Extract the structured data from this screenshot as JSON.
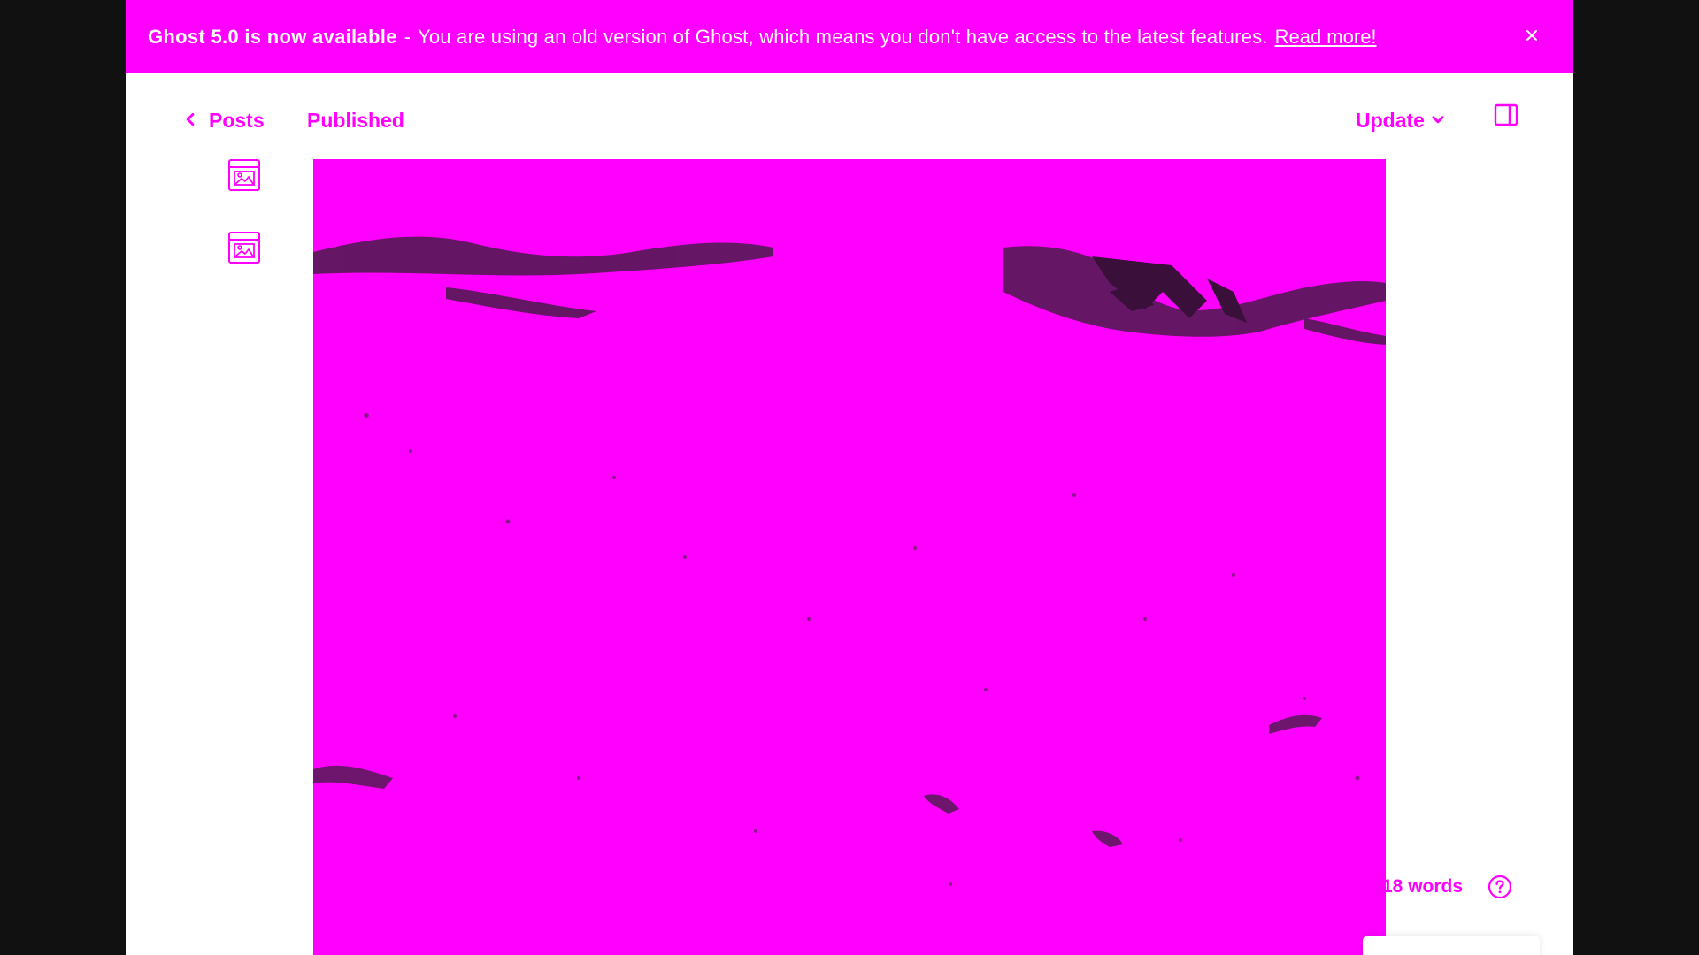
{
  "banner": {
    "title": "Ghost 5.0 is now available",
    "separator": "-",
    "message": "You are using an old version of Ghost, which means you don't have access to the latest features.",
    "link": "Read more!",
    "close_icon": "close-icon"
  },
  "topbar": {
    "back_label": "Posts",
    "back_icon": "chevron-left-icon",
    "status": "Published",
    "update_label": "Update",
    "update_icon": "chevron-down-icon",
    "sidebar_toggle_icon": "sidebar-toggle-icon"
  },
  "side_icons": [
    "image-card-icon",
    "image-card-icon"
  ],
  "editor": {
    "word_count": "18 words",
    "help_icon": "help-icon"
  },
  "colors": {
    "accent": "#ff00ff",
    "background": "#ffffff",
    "outer": "#111111"
  }
}
